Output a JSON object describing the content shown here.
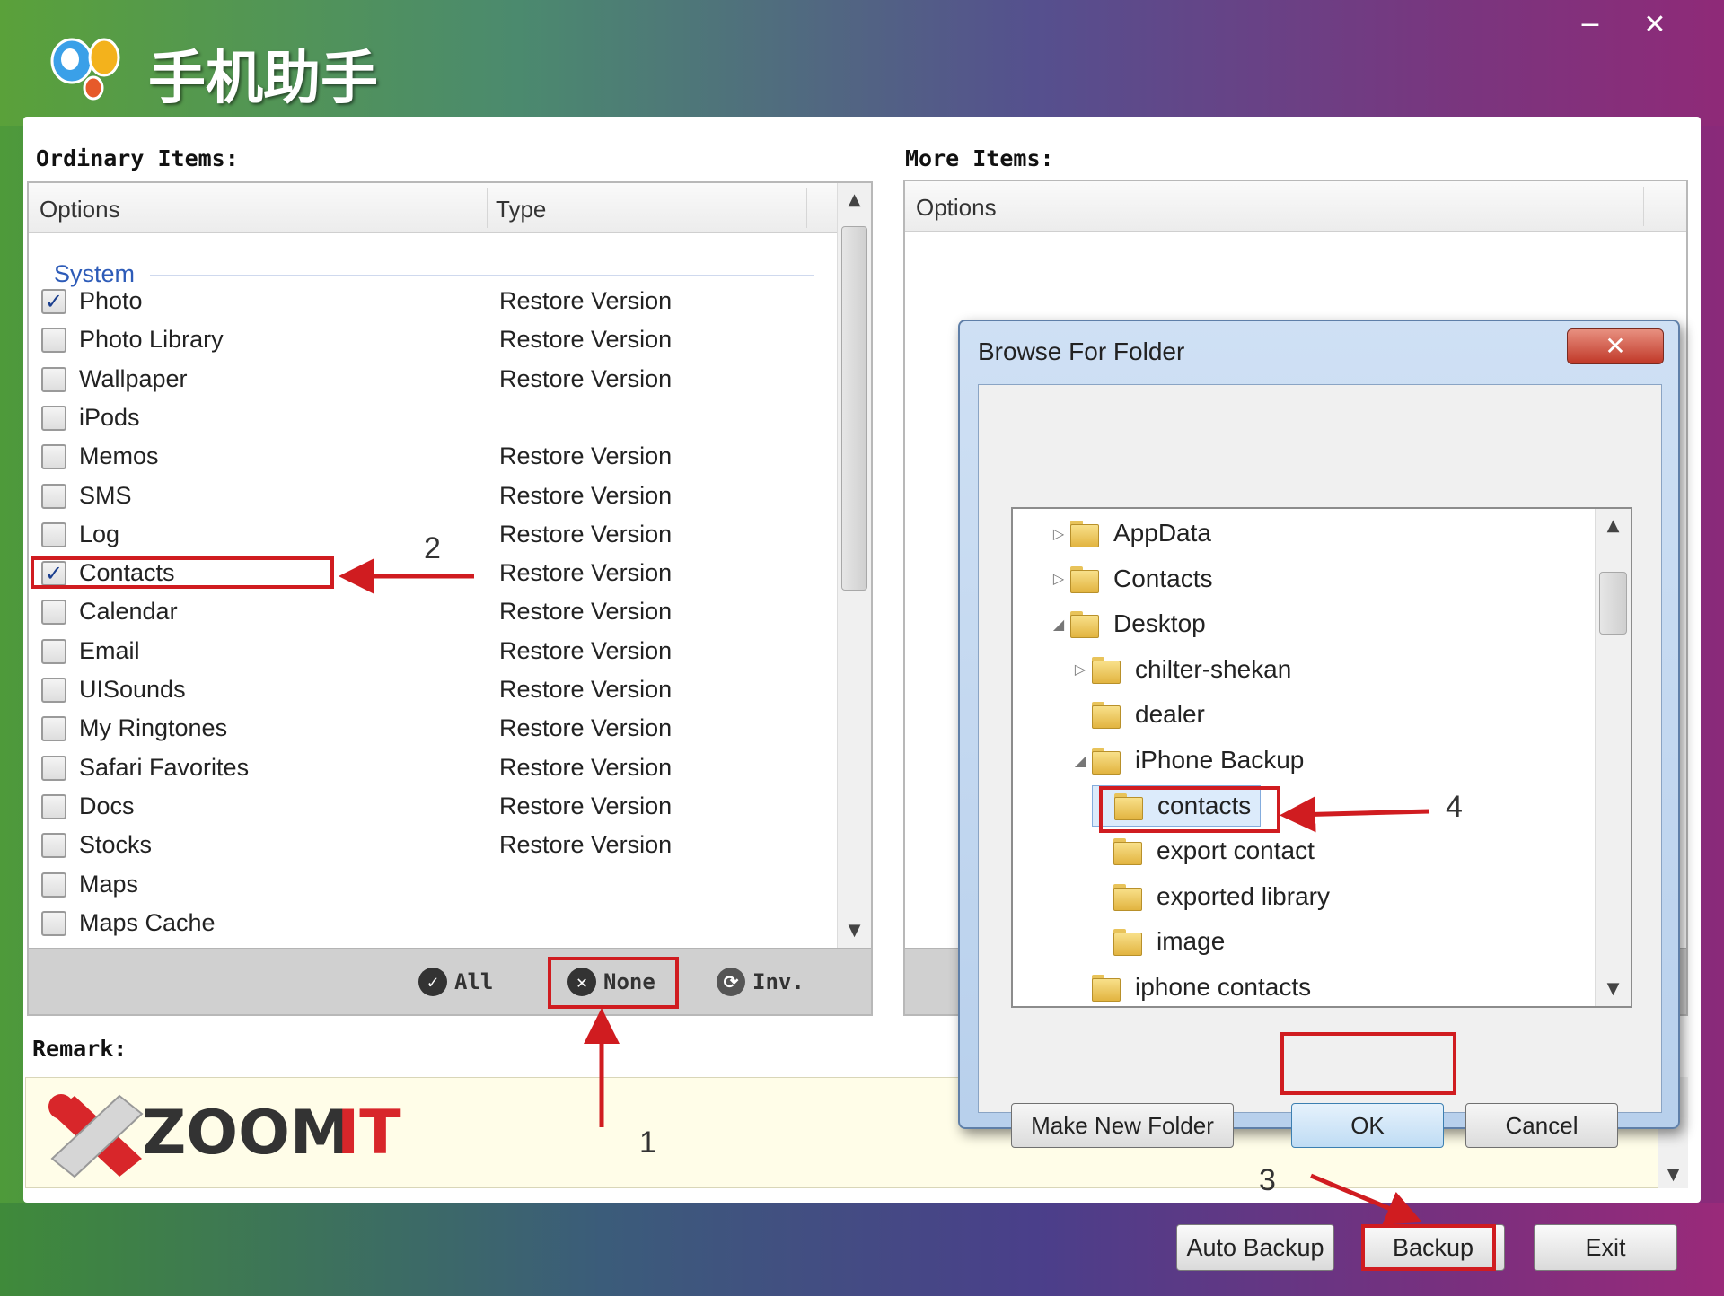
{
  "app": {
    "title": "手机助手",
    "minimize_glyph": "−",
    "close_glyph": "✕"
  },
  "ordinary": {
    "label": "Ordinary Items:",
    "col_options": "Options",
    "col_type": "Type",
    "group": "System",
    "items": [
      {
        "name": "Photo",
        "type": "Restore Version",
        "checked": true
      },
      {
        "name": "Photo Library",
        "type": "Restore Version",
        "checked": false
      },
      {
        "name": "Wallpaper",
        "type": "Restore Version",
        "checked": false
      },
      {
        "name": "iPods",
        "type": "",
        "checked": false
      },
      {
        "name": "Memos",
        "type": "Restore Version",
        "checked": false
      },
      {
        "name": "SMS",
        "type": "Restore Version",
        "checked": false
      },
      {
        "name": "Log",
        "type": "Restore Version",
        "checked": false
      },
      {
        "name": "Contacts",
        "type": "Restore Version",
        "checked": true
      },
      {
        "name": "Calendar",
        "type": "Restore Version",
        "checked": false
      },
      {
        "name": "Email",
        "type": "Restore Version",
        "checked": false
      },
      {
        "name": "UISounds",
        "type": "Restore Version",
        "checked": false
      },
      {
        "name": "My Ringtones",
        "type": "Restore Version",
        "checked": false
      },
      {
        "name": "Safari Favorites",
        "type": "Restore Version",
        "checked": false
      },
      {
        "name": "Docs",
        "type": "Restore Version",
        "checked": false
      },
      {
        "name": "Stocks",
        "type": "Restore Version",
        "checked": false
      },
      {
        "name": "Maps",
        "type": "",
        "checked": false
      },
      {
        "name": "Maps Cache",
        "type": "",
        "checked": false
      }
    ],
    "footer": {
      "all": "All",
      "none": "None",
      "inv": "Inv."
    }
  },
  "more": {
    "label": "More Items:",
    "col_options": "Options"
  },
  "remark": {
    "label": "Remark:"
  },
  "logo": {
    "text": "ZOOMIT",
    "colors": {
      "red": "#d8262a",
      "dark": "#333333"
    }
  },
  "dialog": {
    "title": "Browse For Folder",
    "close": "✕",
    "tree": [
      {
        "label": "AppData",
        "indent": 0,
        "toggle": "▷"
      },
      {
        "label": "Contacts",
        "indent": 0,
        "toggle": "▷"
      },
      {
        "label": "Desktop",
        "indent": 0,
        "toggle": "◢"
      },
      {
        "label": "chilter-shekan",
        "indent": 1,
        "toggle": "▷"
      },
      {
        "label": "dealer",
        "indent": 1,
        "toggle": ""
      },
      {
        "label": "iPhone Backup",
        "indent": 1,
        "toggle": "◢"
      },
      {
        "label": "contacts",
        "indent": 2,
        "toggle": "",
        "selected": true
      },
      {
        "label": "export contact",
        "indent": 2,
        "toggle": ""
      },
      {
        "label": "exported library",
        "indent": 2,
        "toggle": ""
      },
      {
        "label": "image",
        "indent": 2,
        "toggle": ""
      },
      {
        "label": "iphone contacts",
        "indent": 1,
        "toggle": ""
      }
    ],
    "buttons": {
      "new_folder": "Make New Folder",
      "ok": "OK",
      "cancel": "Cancel"
    }
  },
  "bottom": {
    "auto_backup": "Auto Backup",
    "backup": "Backup",
    "exit": "Exit"
  },
  "annotations": [
    "1",
    "2",
    "3",
    "4"
  ],
  "colors": {
    "annotation_red": "#d01c20",
    "group_blue": "#2d5bb8"
  }
}
